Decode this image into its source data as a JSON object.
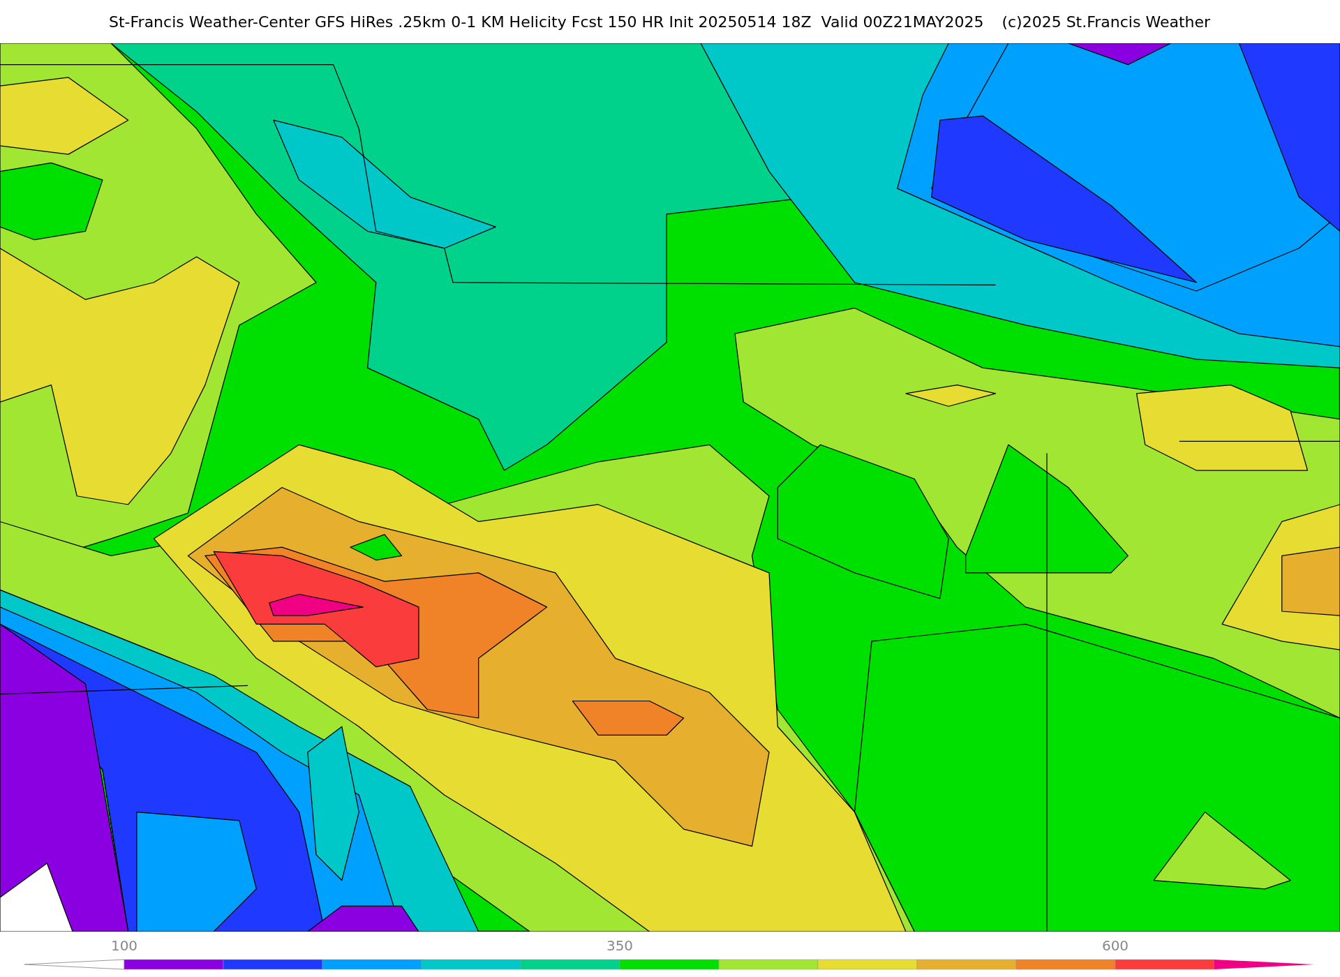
{
  "title": "St-Francis Weather-Center GFS HiRes .25km 0-1 KM Helicity Fcst 150 HR Init 20250514 18Z  Valid 00Z21MAY2025",
  "copyright": "(c)2025 St.Francis Weather",
  "colorbar": {
    "segments": [
      {
        "kind": "under",
        "color": "#ffffff"
      },
      {
        "kind": "bin",
        "color": "#8a00e0",
        "label": "100"
      },
      {
        "kind": "bin",
        "color": "#2039ff"
      },
      {
        "kind": "bin",
        "color": "#00a0ff"
      },
      {
        "kind": "bin",
        "color": "#00c8c8"
      },
      {
        "kind": "bin",
        "color": "#00d28c"
      },
      {
        "kind": "bin",
        "color": "#00e000",
        "label": "350"
      },
      {
        "kind": "bin",
        "color": "#a0e632"
      },
      {
        "kind": "bin",
        "color": "#e6dc32"
      },
      {
        "kind": "bin",
        "color": "#e6af2d"
      },
      {
        "kind": "bin",
        "color": "#f08228"
      },
      {
        "kind": "bin",
        "color": "#fa3c3c",
        "label": "600"
      },
      {
        "kind": "over",
        "color": "#f00082"
      }
    ]
  }
}
